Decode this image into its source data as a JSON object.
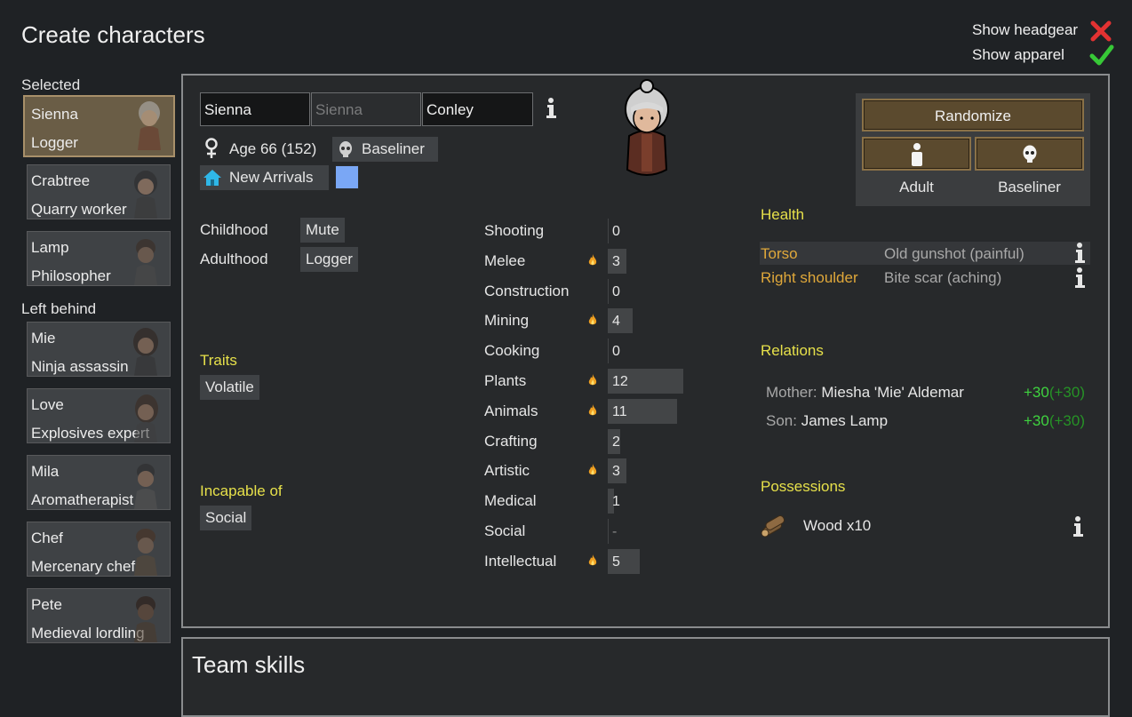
{
  "window": {
    "title": "Create characters"
  },
  "toggles": {
    "headgear_label": "Show headgear",
    "apparel_label": "Show apparel"
  },
  "sidebar": {
    "selected_header": "Selected",
    "left_behind_header": "Left behind",
    "selected": [
      {
        "name": "Sienna",
        "job": "Logger"
      },
      {
        "name": "Crabtree",
        "job": "Quarry worker"
      },
      {
        "name": "Lamp",
        "job": "Philosopher"
      }
    ],
    "left_behind": [
      {
        "name": "Mie",
        "job": "Ninja assassin"
      },
      {
        "name": "Love",
        "job": "Explosives expert"
      },
      {
        "name": "Mila",
        "job": "Aromatherapist"
      },
      {
        "name": "Chef",
        "job": "Mercenary chef"
      },
      {
        "name": "Pete",
        "job": "Medieval lordling"
      }
    ]
  },
  "pawn": {
    "first_name": "Sienna",
    "nick_placeholder": "Sienna",
    "last_name": "Conley",
    "age": "Age 66 (152)",
    "xenotype": "Baseliner",
    "faction": "New Arrivals",
    "favorite_color": "#7aa7f5"
  },
  "buttons": {
    "randomize": "Randomize",
    "dev_stage": "Adult",
    "xeno": "Baseliner"
  },
  "backstory": {
    "childhood_label": "Childhood",
    "childhood_value": "Mute",
    "adulthood_label": "Adulthood",
    "adulthood_value": "Logger"
  },
  "traits": {
    "header": "Traits",
    "items": [
      "Volatile"
    ]
  },
  "incapable": {
    "header": "Incapable of",
    "items": [
      "Social"
    ]
  },
  "skills": [
    {
      "name": "Shooting",
      "value": "0",
      "passion": false,
      "level": 0
    },
    {
      "name": "Melee",
      "value": "3",
      "passion": true,
      "level": 3
    },
    {
      "name": "Construction",
      "value": "0",
      "passion": false,
      "level": 0
    },
    {
      "name": "Mining",
      "value": "4",
      "passion": true,
      "level": 4
    },
    {
      "name": "Cooking",
      "value": "0",
      "passion": false,
      "level": 0
    },
    {
      "name": "Plants",
      "value": "12",
      "passion": true,
      "level": 12
    },
    {
      "name": "Animals",
      "value": "11",
      "passion": true,
      "level": 11
    },
    {
      "name": "Crafting",
      "value": "2",
      "passion": false,
      "level": 2
    },
    {
      "name": "Artistic",
      "value": "3",
      "passion": true,
      "level": 3
    },
    {
      "name": "Medical",
      "value": "1",
      "passion": false,
      "level": 1
    },
    {
      "name": "Social",
      "value": "-",
      "passion": false,
      "level": 0
    },
    {
      "name": "Intellectual",
      "value": "5",
      "passion": true,
      "level": 5
    }
  ],
  "health": {
    "header": "Health",
    "rows": [
      {
        "part": "Torso",
        "condition": "Old gunshot (painful)"
      },
      {
        "part": "Right shoulder",
        "condition": "Bite scar (aching)"
      }
    ]
  },
  "relations": {
    "header": "Relations",
    "rows": [
      {
        "kind": "Mother:",
        "name": "Miesha 'Mie' Aldemar",
        "opinion": "+30",
        "opinion_base": "(+30)"
      },
      {
        "kind": "Son:",
        "name": "James Lamp",
        "opinion": "+30",
        "opinion_base": "(+30)"
      }
    ]
  },
  "possessions": {
    "header": "Possessions",
    "items": [
      {
        "label": "Wood x10"
      }
    ]
  },
  "team": {
    "header": "Team skills"
  },
  "colors": {
    "accent_gold": "#8a7147",
    "title_yellow": "#e6e04a",
    "part_orange": "#e0a83a",
    "opinion_green": "#3fd23f"
  }
}
